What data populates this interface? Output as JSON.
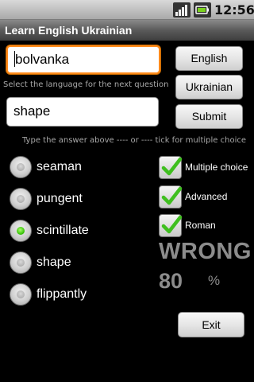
{
  "status_bar": {
    "time": "12:56",
    "icons": [
      "signal-icon",
      "battery-icon"
    ]
  },
  "app": {
    "title": "Learn English Ukrainian"
  },
  "question_field": {
    "value": "bolvanka"
  },
  "answer_field": {
    "value": "shape"
  },
  "language_hint": "Select the language for the next question",
  "answer_hint": "Type the answer above ---- or ---- tick for multiple choice",
  "buttons": {
    "english": "English",
    "ukrainian": "Ukrainian",
    "submit": "Submit",
    "exit": "Exit"
  },
  "choices": [
    {
      "label": "seaman",
      "checked": false
    },
    {
      "label": "pungent",
      "checked": false
    },
    {
      "label": "scintillate",
      "checked": true
    },
    {
      "label": "shape",
      "checked": false
    },
    {
      "label": "flippantly",
      "checked": false
    }
  ],
  "options": [
    {
      "label": "Multiple choice",
      "checked": true
    },
    {
      "label": "Advanced",
      "checked": true
    },
    {
      "label": "Roman",
      "checked": true
    }
  ],
  "result": "WRONG",
  "score": "80",
  "score_unit": "%",
  "colors": {
    "focus_border": "#ff8a1a",
    "radio_checked": "#2dbb00",
    "checkmark": "#3fbf1f",
    "result_text": "#8c8c8c"
  }
}
